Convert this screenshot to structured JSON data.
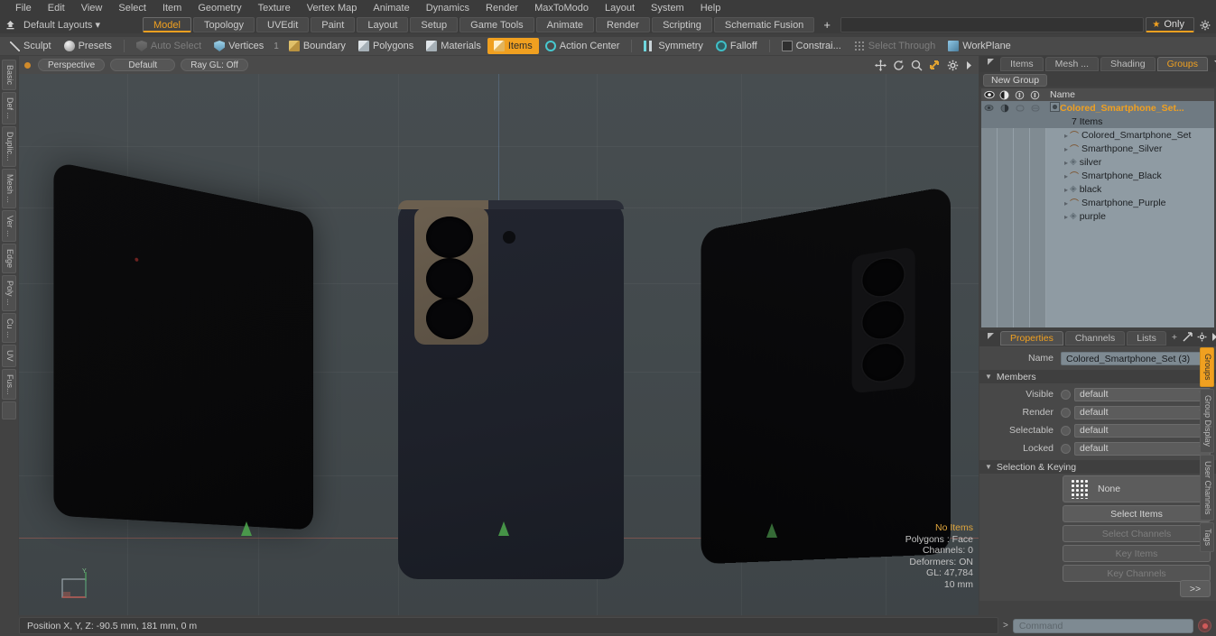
{
  "app": {
    "menu": [
      "File",
      "Edit",
      "View",
      "Select",
      "Item",
      "Geometry",
      "Texture",
      "Vertex Map",
      "Animate",
      "Dynamics",
      "Render",
      "MaxToModo",
      "Layout",
      "System",
      "Help"
    ],
    "layout_selector": "Default Layouts ▾",
    "layout_tabs": [
      {
        "label": "Model",
        "active": true
      },
      {
        "label": "Topology",
        "active": false
      },
      {
        "label": "UVEdit",
        "active": false
      },
      {
        "label": "Paint",
        "active": false
      },
      {
        "label": "Layout",
        "active": false
      },
      {
        "label": "Setup",
        "active": false
      },
      {
        "label": "Game Tools",
        "active": false
      },
      {
        "label": "Animate",
        "active": false
      },
      {
        "label": "Render",
        "active": false
      },
      {
        "label": "Scripting",
        "active": false
      },
      {
        "label": "Schematic Fusion",
        "active": false
      }
    ],
    "add_tab": "+",
    "only_button": "Only"
  },
  "modebar": {
    "sculpt": "Sculpt",
    "presets": "Presets",
    "items": [
      {
        "label": "Auto Select",
        "icon": "shield-icon",
        "state": "disabled"
      },
      {
        "label": "Vertices",
        "icon": "vertex-icon",
        "state": "normal"
      },
      {
        "label": "Boundary",
        "icon": "boundary-icon",
        "state": "normal"
      },
      {
        "label": "Polygons",
        "icon": "polygon-icon",
        "state": "normal"
      },
      {
        "label": "Materials",
        "icon": "material-icon",
        "state": "normal"
      },
      {
        "label": "Items",
        "icon": "items-icon",
        "state": "selected"
      },
      {
        "label": "Action Center",
        "icon": "action-center-icon",
        "state": "normal"
      },
      {
        "label": "Symmetry",
        "icon": "symmetry-icon",
        "state": "normal"
      },
      {
        "label": "Falloff",
        "icon": "falloff-icon",
        "state": "normal"
      },
      {
        "label": "Constrai...",
        "icon": "constraint-icon",
        "state": "normal"
      },
      {
        "label": "Select Through",
        "icon": "select-through-icon",
        "state": "disabled"
      },
      {
        "label": "WorkPlane",
        "icon": "workplane-icon",
        "state": "normal"
      }
    ],
    "vertices_count": "1"
  },
  "left_tabs": [
    "Basic",
    "Def ...",
    "Duplic...",
    "Mesh ...",
    "Ver ...",
    "Edge",
    "Poly ...",
    "Cu ...",
    "UV",
    "Fus..."
  ],
  "right_tabs": [
    {
      "label": "Groups",
      "active": true
    },
    {
      "label": "Group Display",
      "active": false
    },
    {
      "label": "User Channels",
      "active": false
    },
    {
      "label": "Tags",
      "active": false
    }
  ],
  "viewport": {
    "projection": "Perspective",
    "shading": "Default",
    "raygl": "Ray GL: Off",
    "icons": [
      "pan-icon",
      "rotate-icon",
      "zoom-icon",
      "fit-icon",
      "gear-icon",
      "arrow-icon"
    ],
    "stats": {
      "selection": "No Items",
      "polygons": "Polygons : Face",
      "channels": "Channels: 0",
      "deformers": "Deformers: ON",
      "gl": "GL: 47,784",
      "scale": "10 mm"
    }
  },
  "groups_panel": {
    "tabs": [
      {
        "label": "Items",
        "active": false
      },
      {
        "label": "Mesh ...",
        "active": false
      },
      {
        "label": "Shading",
        "active": false
      },
      {
        "label": "Groups",
        "active": true
      }
    ],
    "new_group_button": "New Group",
    "column_icons": [
      "visible-eye-icon",
      "render-icon",
      "lock-icon",
      "select-icon"
    ],
    "name_column": "Name",
    "tree": [
      {
        "name": "Colored_Smartphone_Set...",
        "type": "group",
        "selected": true,
        "indent": 0
      },
      {
        "name": "7 Items",
        "type": "count",
        "selected": true,
        "indent": 1
      },
      {
        "name": "Colored_Smartphone_Set",
        "type": "mesh",
        "selected": false,
        "indent": 1
      },
      {
        "name": "Smarthpone_Silver",
        "type": "mesh",
        "selected": false,
        "indent": 1
      },
      {
        "name": "silver",
        "type": "material",
        "selected": false,
        "indent": 1
      },
      {
        "name": "Smartphone_Black",
        "type": "mesh",
        "selected": false,
        "indent": 1
      },
      {
        "name": "black",
        "type": "material",
        "selected": false,
        "indent": 1
      },
      {
        "name": "Smartphone_Purple",
        "type": "mesh",
        "selected": false,
        "indent": 1
      },
      {
        "name": "purple",
        "type": "material",
        "selected": false,
        "indent": 1
      }
    ]
  },
  "properties_panel": {
    "tabs": [
      {
        "label": "Properties",
        "active": true
      },
      {
        "label": "Channels",
        "active": false
      },
      {
        "label": "Lists",
        "active": false
      },
      {
        "label": "+",
        "active": false
      }
    ],
    "name_label": "Name",
    "name_value": "Colored_Smartphone_Set (3)",
    "members_section": "Members",
    "members": [
      {
        "label": "Visible",
        "value": "default"
      },
      {
        "label": "Render",
        "value": "default"
      },
      {
        "label": "Selectable",
        "value": "default"
      },
      {
        "label": "Locked",
        "value": "default"
      }
    ],
    "selection_section": "Selection & Keying",
    "selection_mode": "None",
    "buttons": [
      {
        "label": "Select Items",
        "enabled": true
      },
      {
        "label": "Select Channels",
        "enabled": false
      },
      {
        "label": "Key Items",
        "enabled": false
      },
      {
        "label": "Key Channels",
        "enabled": false
      }
    ],
    "expand_button": ">>"
  },
  "statusbar": {
    "position": "Position X, Y, Z:   -90.5 mm, 181 mm, 0 m",
    "command_placeholder": "Command",
    "command_value": ""
  },
  "colors": {
    "accent": "#f0a020",
    "panel": "#424242",
    "viewport_bg": "#41474a",
    "tree_bg": "#8f9ba3"
  }
}
